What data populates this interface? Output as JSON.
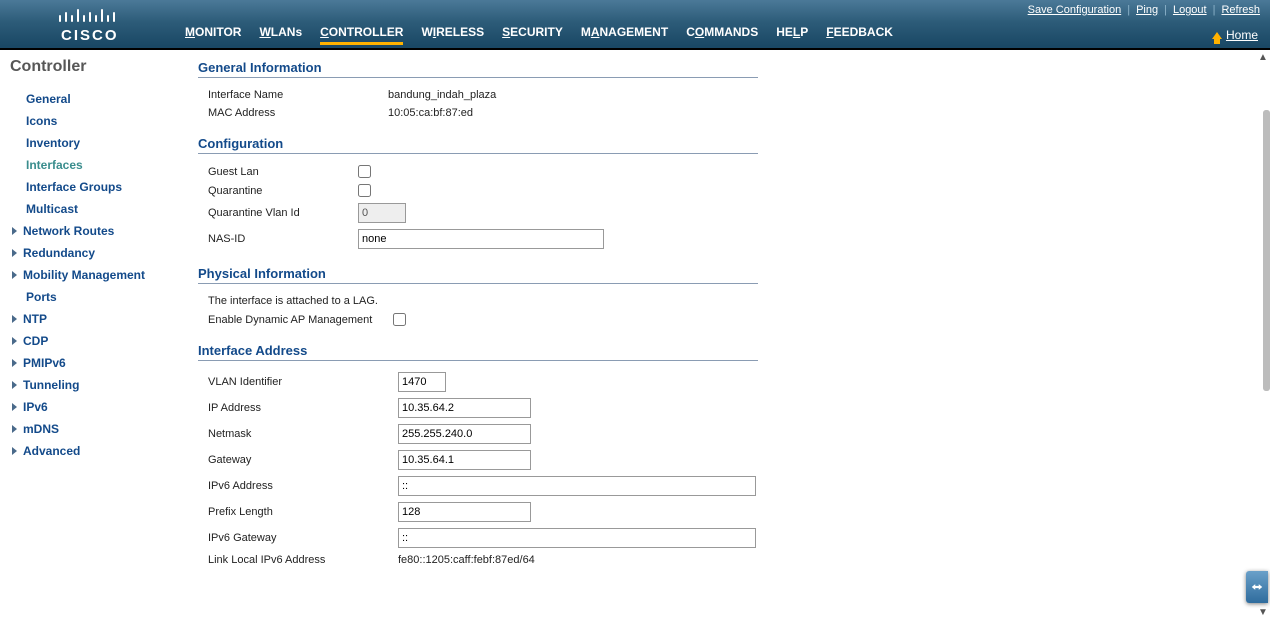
{
  "topbar": {
    "nav": [
      {
        "pre": "M",
        "und": "M",
        "rest": "ONITOR"
      },
      {
        "pre": "",
        "und": "W",
        "rest": "LANs"
      },
      {
        "pre": "",
        "und": "C",
        "rest": "ONTROLLER"
      },
      {
        "pre": "W",
        "und": "I",
        "rest": "RELESS"
      },
      {
        "pre": "",
        "und": "S",
        "rest": "ECURITY"
      },
      {
        "pre": "M",
        "und": "A",
        "rest": "NAGEMENT"
      },
      {
        "pre": "C",
        "und": "O",
        "rest": "MMANDS"
      },
      {
        "pre": "HE",
        "und": "L",
        "rest": "P"
      },
      {
        "pre": "",
        "und": "F",
        "rest": "EEDBACK"
      }
    ],
    "save": "Save Configuration",
    "ping": "Ping",
    "logout": "Logout",
    "refresh": "Refresh",
    "home": "Home"
  },
  "sidebar": {
    "title": "Controller",
    "items": [
      {
        "label": "General",
        "type": "leaf"
      },
      {
        "label": "Icons",
        "type": "leaf"
      },
      {
        "label": "Inventory",
        "type": "leaf"
      },
      {
        "label": "Interfaces",
        "type": "leaf",
        "active": true
      },
      {
        "label": "Interface Groups",
        "type": "leaf"
      },
      {
        "label": "Multicast",
        "type": "leaf"
      },
      {
        "label": "Network Routes",
        "type": "collapsed"
      },
      {
        "label": "Redundancy",
        "type": "collapsed"
      },
      {
        "label": "Mobility Management",
        "type": "collapsed"
      },
      {
        "label": "Ports",
        "type": "leaf"
      },
      {
        "label": "NTP",
        "type": "collapsed"
      },
      {
        "label": "CDP",
        "type": "collapsed"
      },
      {
        "label": "PMIPv6",
        "type": "collapsed"
      },
      {
        "label": "Tunneling",
        "type": "collapsed"
      },
      {
        "label": "IPv6",
        "type": "collapsed"
      },
      {
        "label": "mDNS",
        "type": "collapsed"
      },
      {
        "label": "Advanced",
        "type": "collapsed"
      }
    ]
  },
  "sections": {
    "general_info": {
      "title": "General Information",
      "interface_name_label": "Interface Name",
      "interface_name_value": "bandung_indah_plaza",
      "mac_label": "MAC Address",
      "mac_value": "10:05:ca:bf:87:ed"
    },
    "configuration": {
      "title": "Configuration",
      "guest_lan_label": "Guest Lan",
      "quarantine_label": "Quarantine",
      "quarantine_vlan_label": "Quarantine Vlan Id",
      "quarantine_vlan_value": "0",
      "nasid_label": "NAS-ID",
      "nasid_value": "none"
    },
    "physical": {
      "title": "Physical Information",
      "lag_note": "The interface is attached to a LAG.",
      "dyn_ap_label": "Enable Dynamic AP Management"
    },
    "iface_addr": {
      "title": "Interface Address",
      "vlan_label": "VLAN Identifier",
      "vlan_value": "1470",
      "ip_label": "IP Address",
      "ip_value": "10.35.64.2",
      "netmask_label": "Netmask",
      "netmask_value": "255.255.240.0",
      "gateway_label": "Gateway",
      "gateway_value": "10.35.64.1",
      "ipv6_label": "IPv6 Address",
      "ipv6_value": "::",
      "prefix_label": "Prefix Length",
      "prefix_value": "128",
      "ipv6gw_label": "IPv6 Gateway",
      "ipv6gw_value": "::",
      "linklocal_label": "Link Local IPv6 Address",
      "linklocal_value": "fe80::1205:caff:febf:87ed/64"
    }
  }
}
